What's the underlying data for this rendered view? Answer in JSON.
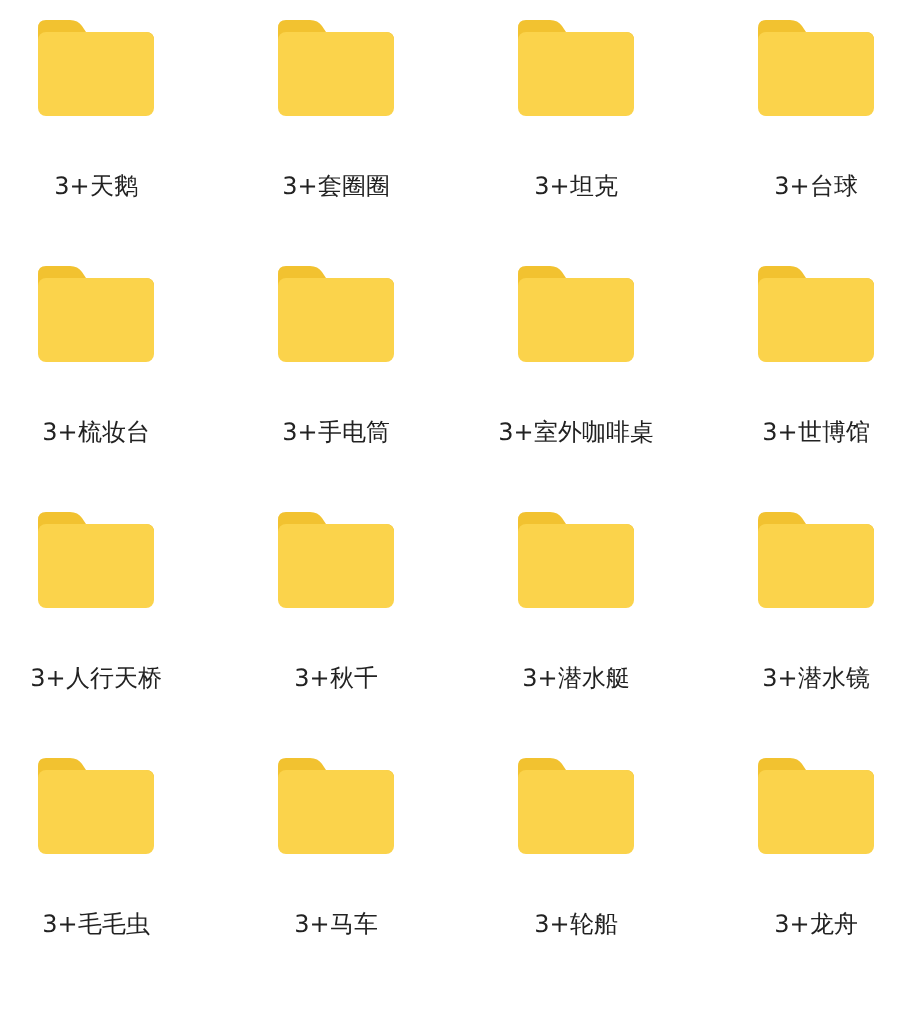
{
  "folders": [
    {
      "label": "3+天鹅"
    },
    {
      "label": "3+套圈圈"
    },
    {
      "label": "3+坦克"
    },
    {
      "label": "3+台球"
    },
    {
      "label": "3+梳妆台"
    },
    {
      "label": "3+手电筒"
    },
    {
      "label": "3+室外咖啡桌"
    },
    {
      "label": "3+世博馆"
    },
    {
      "label": "3+人行天桥"
    },
    {
      "label": "3+秋千"
    },
    {
      "label": "3+潜水艇"
    },
    {
      "label": "3+潜水镜"
    },
    {
      "label": "3+毛毛虫"
    },
    {
      "label": "3+马车"
    },
    {
      "label": "3+轮船"
    },
    {
      "label": "3+龙舟"
    }
  ]
}
